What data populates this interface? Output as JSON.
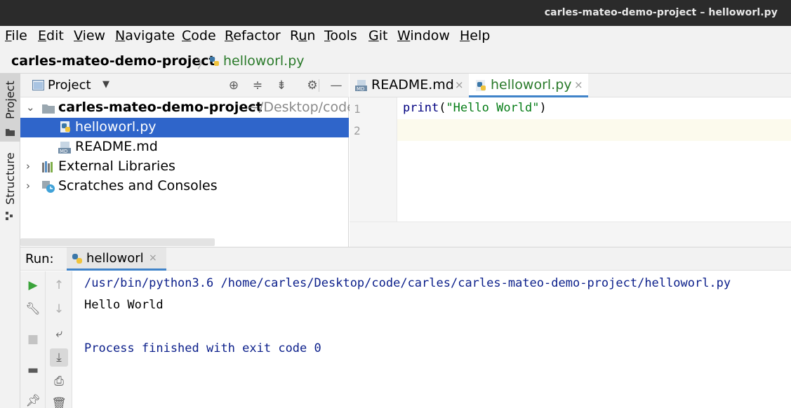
{
  "window": {
    "title": "carles-mateo-demo-project – helloworl.py"
  },
  "menu": [
    {
      "pre": "",
      "u": "F",
      "post": "ile"
    },
    {
      "pre": "",
      "u": "E",
      "post": "dit"
    },
    {
      "pre": "",
      "u": "V",
      "post": "iew"
    },
    {
      "pre": "",
      "u": "N",
      "post": "avigate"
    },
    {
      "pre": "",
      "u": "C",
      "post": "ode"
    },
    {
      "pre": "",
      "u": "R",
      "post": "efactor"
    },
    {
      "pre": "R",
      "u": "u",
      "post": "n"
    },
    {
      "pre": "",
      "u": "T",
      "post": "ools"
    },
    {
      "pre": "",
      "u": "G",
      "post": "it"
    },
    {
      "pre": "",
      "u": "W",
      "post": "indow"
    },
    {
      "pre": "",
      "u": "H",
      "post": "elp"
    }
  ],
  "breadcrumb": {
    "project": "carles-mateo-demo-project",
    "file": "helloworl.py"
  },
  "sidebar": {
    "project_tab": "Project",
    "structure_tab": "Structure"
  },
  "project_panel": {
    "title": "Project",
    "root": {
      "name": "carles-mateo-demo-project",
      "path": "~/Desktop/code"
    },
    "files": [
      "helloworl.py",
      "README.md"
    ],
    "external_libraries": "External Libraries",
    "scratches": "Scratches and Consoles"
  },
  "editor": {
    "tabs": [
      {
        "label": "README.md",
        "close": "×"
      },
      {
        "label": "helloworl.py",
        "close": "×"
      }
    ],
    "line_numbers": [
      "1",
      "2"
    ],
    "code": {
      "fn": "print",
      "open": "(",
      "str": "\"Hello World\"",
      "close": ")"
    }
  },
  "run": {
    "label": "Run:",
    "tab": "helloworl",
    "tab_close": "×",
    "console": {
      "command": "/usr/bin/python3.6 /home/carles/Desktop/code/carles/carles-mateo-demo-project/helloworl.py",
      "output": "Hello World",
      "finished": "Process finished with exit code 0"
    }
  },
  "colors": {
    "selection": "#2f65ca",
    "string": "#067d17",
    "keyword": "#000080",
    "console_system": "#0a1e8a",
    "active_tab_underline": "#4083c9",
    "run_green": "#3aa33a"
  }
}
